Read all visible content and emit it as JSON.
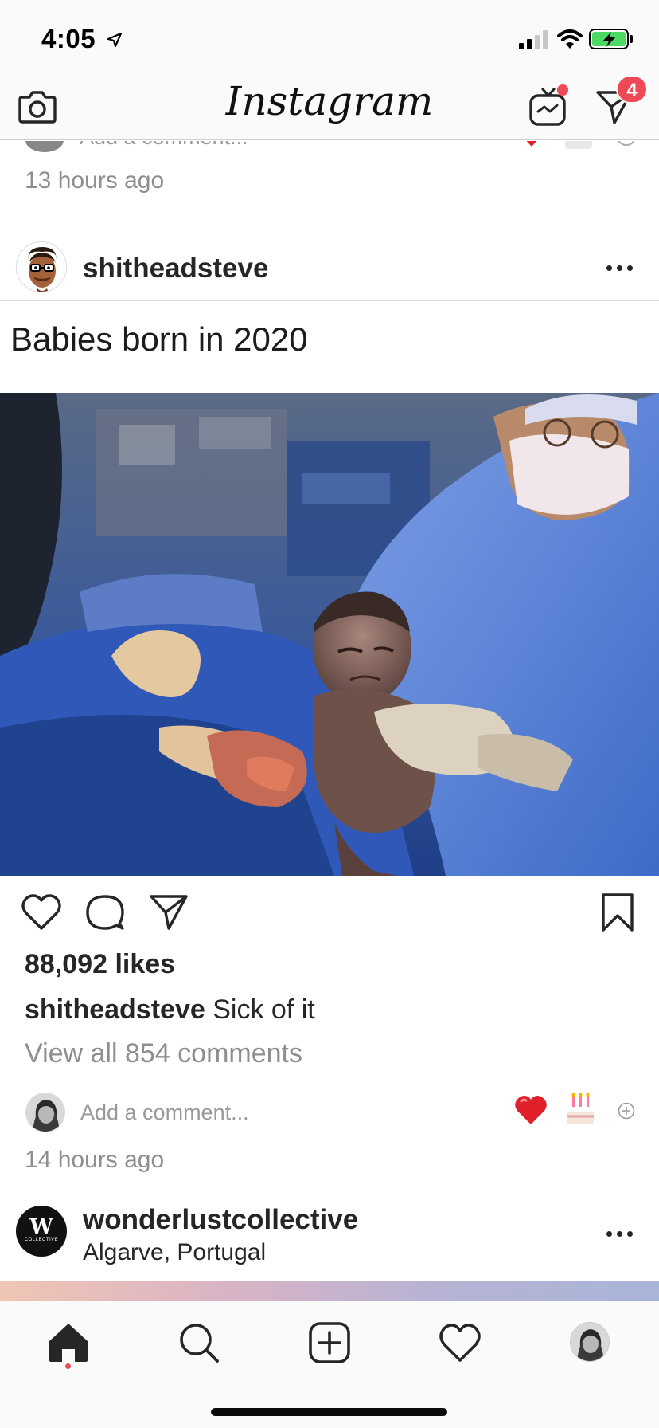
{
  "status_bar": {
    "time": "4:05",
    "battery_color": "#4cd964"
  },
  "nav": {
    "logo": "Instagram",
    "igtv_icon": "igtv-icon",
    "camera_icon": "camera-icon",
    "direct_icon": "paper-plane-icon",
    "direct_badge": "4",
    "badge_color": "#ed4956"
  },
  "previous_post": {
    "add_comment_placeholder": "Add a comment...",
    "timestamp": "13 hours ago"
  },
  "post": {
    "username": "shitheadsteve",
    "image_text": "Babies born in 2020",
    "likes": "88,092 likes",
    "caption_user": "shitheadsteve",
    "caption_text": " Sick of it",
    "view_comments": "View all 854 comments",
    "add_comment_placeholder": "Add a comment...",
    "quick_reactions": [
      "❤️",
      "🎂"
    ],
    "timestamp": "14 hours ago"
  },
  "next_post": {
    "username": "wonderlustcollective",
    "location": "Algarve, Portugal",
    "avatar_letter": "W",
    "avatar_subtext": "COLLECTIVE"
  },
  "tab_bar": {
    "tabs": [
      "home-icon",
      "search-icon",
      "new-post-icon",
      "activity-heart-icon",
      "profile-avatar"
    ]
  }
}
